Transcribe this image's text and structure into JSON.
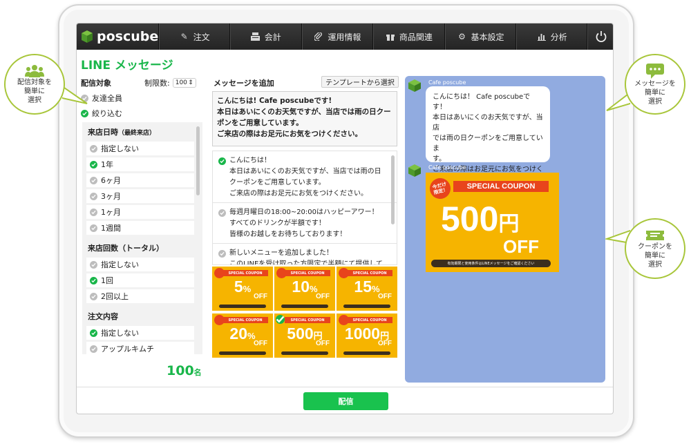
{
  "app": {
    "brand": "poscube"
  },
  "nav": {
    "items": [
      {
        "label": "注文",
        "icon": "pencil-icon"
      },
      {
        "label": "会計",
        "icon": "register-icon"
      },
      {
        "label": "運用情報",
        "icon": "paperclip-icon"
      },
      {
        "label": "商品関連",
        "icon": "gift-icon"
      },
      {
        "label": "基本設定",
        "icon": "gears-icon"
      },
      {
        "label": "分析",
        "icon": "bar-chart-icon"
      }
    ],
    "power_icon": "power-icon"
  },
  "page": {
    "title": "LINE メッセージ"
  },
  "target": {
    "label": "配信対象",
    "limit_label": "制限数:",
    "limit_value": "100",
    "options": [
      "友達全員",
      "絞り込む"
    ],
    "selected": 1
  },
  "filters": {
    "visit_date": {
      "title": "来店日時",
      "subtitle": "（最終来店）",
      "options": [
        "指定しない",
        "1年",
        "6ヶ月",
        "3ヶ月",
        "1ヶ月",
        "1週間"
      ],
      "selected": 1
    },
    "visit_count": {
      "title": "来店回数（トータル）",
      "options": [
        "指定しない",
        "1回",
        "2回以上"
      ],
      "selected": 1
    },
    "order": {
      "title": "注文内容",
      "options": [
        "指定しない",
        "アップルキムチ"
      ],
      "selected": 0
    }
  },
  "recipient_count": {
    "value": "100",
    "unit": "名"
  },
  "compose": {
    "label": "メッセージを追加",
    "template_button": "テンプレートから選択",
    "text": "こんにちは! Cafe poscubeです!\n本日はあいにくのお天気ですが、当店では雨の日クーポンをご用意しています。\nご来店の際はお足元にお気をつけください。"
  },
  "templates": [
    {
      "text": "こんにちは！\n本日はあいにくのお天気ですが、当店では雨の日\nクーポンをご用意しています。\nご来店の際はお足元にお気をつけください。",
      "selected": true
    },
    {
      "text": "毎週月曜日の18:00~20:00はハッピーアワー！\nすべてのドリンクが半額です！\n皆様のお越しをお待ちしております！",
      "selected": false
    },
    {
      "text": "新しいメニューを追加しました！\nこのLINEを受け取った方限定で半額にて提供して\nいます！",
      "selected": false
    }
  ],
  "coupons": {
    "ribbon": "SPECIAL COUPON",
    "off": "OFF",
    "items": [
      {
        "value": "5",
        "unit": "%",
        "selected": false
      },
      {
        "value": "10",
        "unit": "%",
        "selected": false
      },
      {
        "value": "15",
        "unit": "%",
        "selected": false
      },
      {
        "value": "20",
        "unit": "%",
        "selected": false
      },
      {
        "value": "500",
        "unit": "円",
        "selected": true
      },
      {
        "value": "1000",
        "unit": "円",
        "selected": false
      }
    ]
  },
  "preview": {
    "sender": "Cafe poscube",
    "message": "こんにちは！ Cafe poscubeです！\n本日はあいにくのお天気ですが、当店\nでは雨の日クーポンをご用意していま\nす。\nご来店の際はお足元にお気をつけくだ\nさい。",
    "coupon": {
      "badge": "今だけ\n限定！",
      "ribbon": "SPECIAL COUPON",
      "value": "500",
      "unit": "円",
      "off": "OFF",
      "footer": "有効期限と使用条件はLINEメッセージをご確認ください"
    }
  },
  "send_button": "配信",
  "callouts": [
    {
      "text": "配信対象を\n簡単に\n選択",
      "icon": "users-icon"
    },
    {
      "text": "メッセージを\n簡単に\n選択",
      "icon": "chat-bubble-icon"
    },
    {
      "text": "クーポンを\n簡単に\n選択",
      "icon": "ticket-icon"
    }
  ],
  "colors": {
    "brand_green": "#19b64a",
    "coupon_yellow": "#f6b400",
    "coupon_red": "#e8441c",
    "preview_bg": "#91abe0",
    "callout_green": "#a8c63a"
  }
}
